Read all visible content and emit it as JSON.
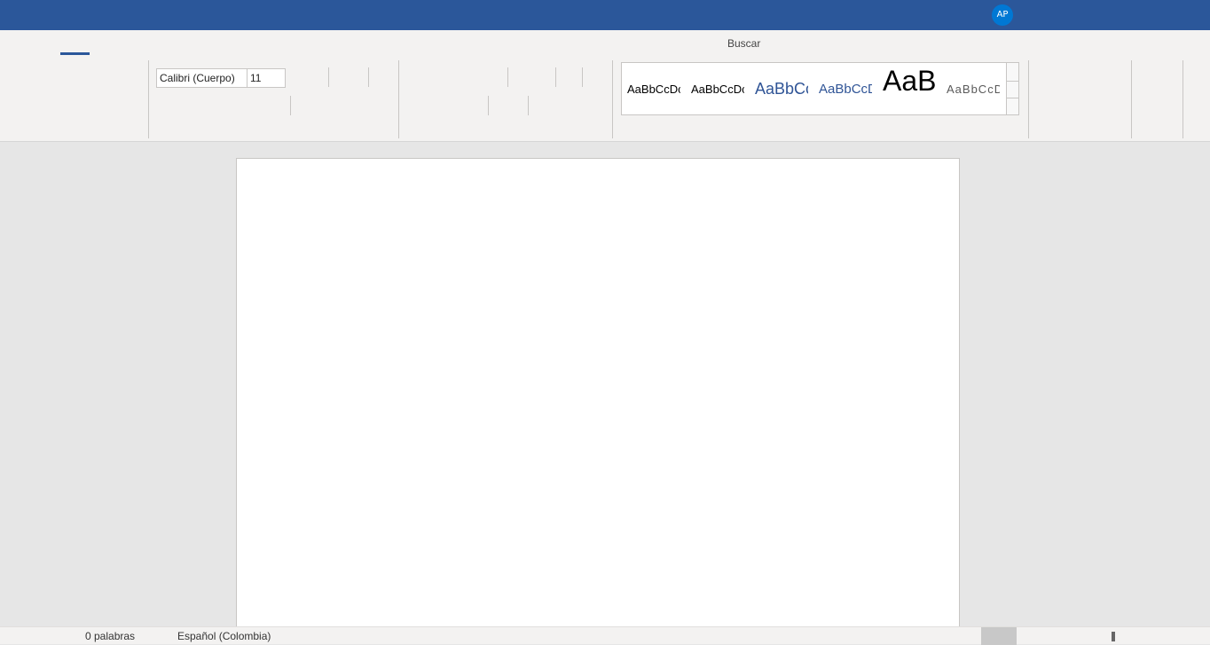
{
  "titlebar": {
    "user_initials": "AP",
    "brand_color": "#2b579a"
  },
  "ribbon": {
    "search_label": "Buscar",
    "font": {
      "name": "Calibri (Cuerpo)",
      "size": "11"
    },
    "styles": [
      {
        "sample": "AaBbCcDc"
      },
      {
        "sample": "AaBbCcDc"
      },
      {
        "sample": "AaBbCc"
      },
      {
        "sample": "AaBbCcD"
      },
      {
        "sample": "AaB"
      },
      {
        "sample": "AaBbCcD"
      }
    ]
  },
  "statusbar": {
    "word_count": "0 palabras",
    "language": "Español (Colombia)"
  }
}
